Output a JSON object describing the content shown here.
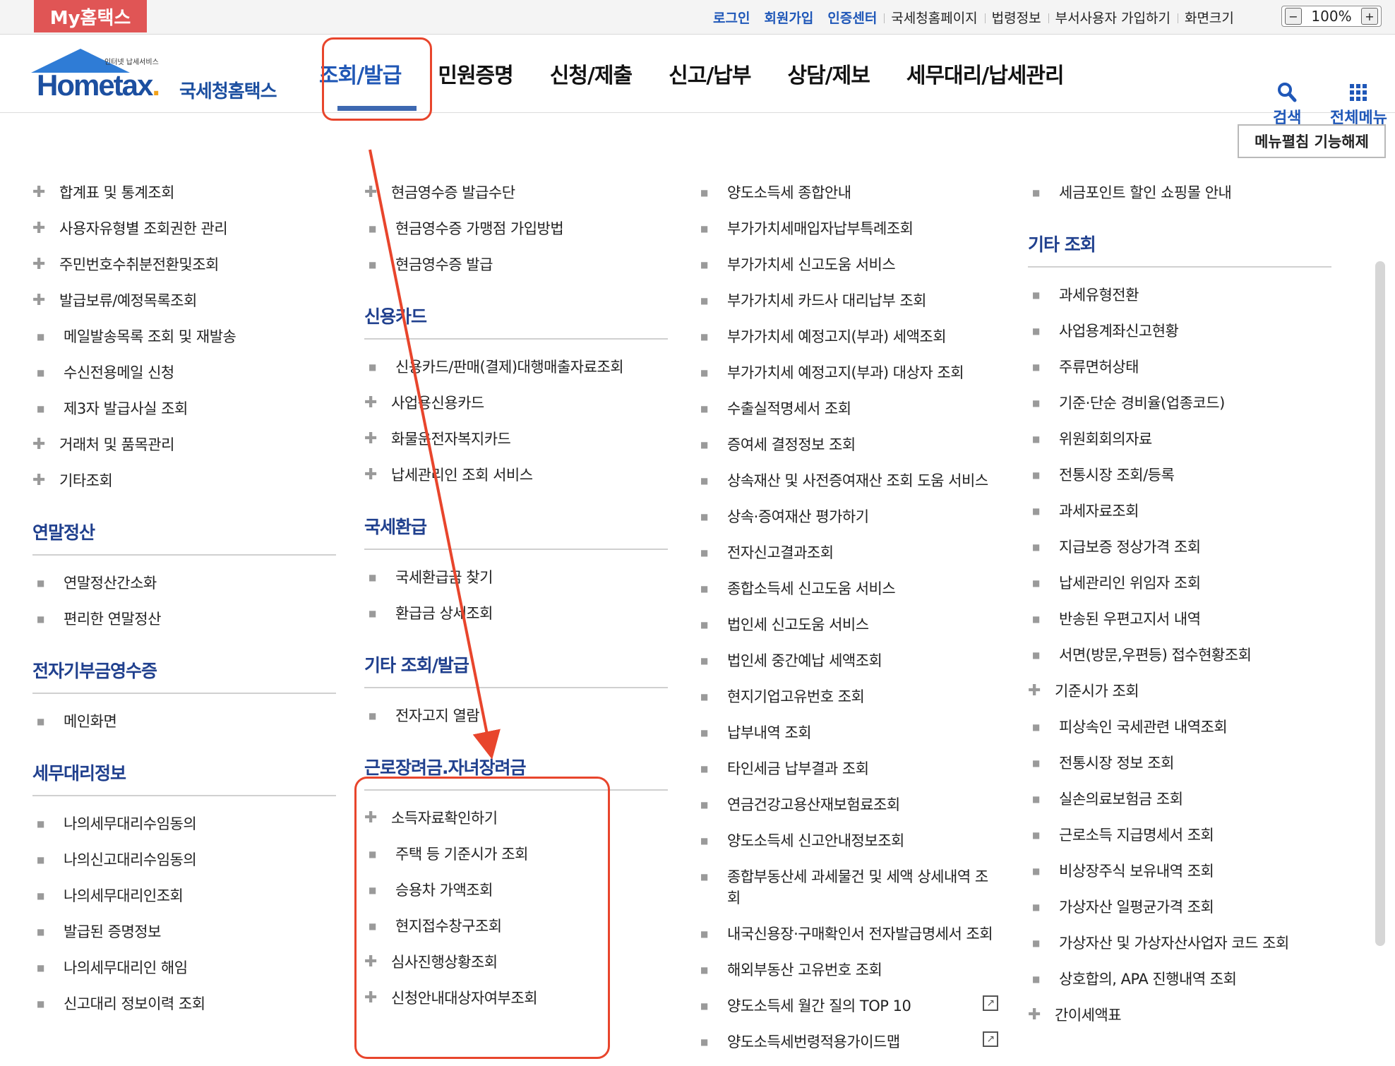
{
  "topbar": {
    "my_button": "My홈택스",
    "links": [
      {
        "label": "로그인",
        "style": "blue"
      },
      {
        "label": "회원가입",
        "style": "blue"
      },
      {
        "label": "인증센터",
        "style": "blue"
      },
      {
        "label": "국세청홈페이지",
        "style": "plain"
      },
      {
        "label": "법령정보",
        "style": "plain"
      },
      {
        "label": "부서사용자 가입하기",
        "style": "plain"
      },
      {
        "label": "화면크기",
        "style": "plain"
      }
    ],
    "zoom": {
      "minus": "−",
      "value": "100%",
      "plus": "+"
    }
  },
  "header": {
    "logo": {
      "small": "인터넷 납세서비스",
      "main": "Hometax",
      "dot": ".",
      "korean": "국세청홈택스"
    },
    "menus": [
      "조회/발급",
      "민원증명",
      "신청/제출",
      "신고/납부",
      "상담/제보",
      "세무대리/납세관리"
    ],
    "active_menu": 0,
    "search": {
      "label": "검색",
      "icon": "search-icon"
    },
    "all_menu": {
      "label": "전체메뉴",
      "icon": "grid-icon"
    }
  },
  "fold_button": "메뉴펼침 기능해제",
  "colors": {
    "accent_blue": "#1f57b8",
    "section_title": "#20408e",
    "highlight_red": "#e8452c",
    "my_button_red": "#e05555"
  },
  "columns": [
    {
      "blocks": [
        {
          "type": "items",
          "items": [
            {
              "icon": "plus",
              "text": "합계표 및 통계조회"
            },
            {
              "icon": "plus",
              "text": "사용자유형별 조회권한 관리"
            },
            {
              "icon": "plus",
              "text": "주민번호수취분전환및조회"
            },
            {
              "icon": "plus",
              "text": "발급보류/예정목록조회"
            },
            {
              "icon": "bullet",
              "text": "메일발송목록 조회 및 재발송"
            },
            {
              "icon": "bullet",
              "text": "수신전용메일 신청"
            },
            {
              "icon": "bullet",
              "text": "제3자 발급사실 조회"
            },
            {
              "icon": "plus",
              "text": "거래처 및 품목관리"
            },
            {
              "icon": "plus",
              "text": "기타조회"
            }
          ]
        },
        {
          "type": "section",
          "title": "연말정산",
          "items": [
            {
              "icon": "bullet",
              "text": "연말정산간소화"
            },
            {
              "icon": "bullet",
              "text": "편리한 연말정산"
            }
          ]
        },
        {
          "type": "section",
          "title": "전자기부금영수증",
          "items": [
            {
              "icon": "bullet",
              "text": "메인화면"
            }
          ]
        },
        {
          "type": "section",
          "title": "세무대리정보",
          "items": [
            {
              "icon": "bullet",
              "text": "나의세무대리수임동의"
            },
            {
              "icon": "bullet",
              "text": "나의신고대리수임동의"
            },
            {
              "icon": "bullet",
              "text": "나의세무대리인조회"
            },
            {
              "icon": "bullet",
              "text": "발급된 증명정보"
            },
            {
              "icon": "bullet",
              "text": "나의세무대리인 해임"
            },
            {
              "icon": "bullet",
              "text": "신고대리 정보이력 조회"
            }
          ]
        }
      ]
    },
    {
      "blocks": [
        {
          "type": "items",
          "items": [
            {
              "icon": "plus",
              "text": "현금영수증 발급수단"
            },
            {
              "icon": "bullet",
              "text": "현금영수증 가맹점 가입방법"
            },
            {
              "icon": "bullet",
              "text": "현금영수증 발급"
            }
          ]
        },
        {
          "type": "section",
          "title": "신용카드",
          "items": [
            {
              "icon": "bullet",
              "text": "신용카드/판매(결제)대행매출자료조회"
            },
            {
              "icon": "plus",
              "text": "사업용신용카드"
            },
            {
              "icon": "plus",
              "text": "화물운전자복지카드"
            },
            {
              "icon": "plus",
              "text": "납세관리인 조회 서비스"
            }
          ]
        },
        {
          "type": "section",
          "title": "국세환급",
          "items": [
            {
              "icon": "bullet",
              "text": "국세환급금 찾기"
            },
            {
              "icon": "bullet",
              "text": "환급금 상세조회"
            }
          ]
        },
        {
          "type": "section",
          "title": "기타 조회/발급",
          "items": [
            {
              "icon": "bullet",
              "text": "전자고지 열람"
            }
          ]
        },
        {
          "type": "section",
          "title": "근로장려금.자녀장려금",
          "items": [
            {
              "icon": "plus",
              "text": "소득자료확인하기"
            },
            {
              "icon": "bullet",
              "text": "주택 등 기준시가 조회"
            },
            {
              "icon": "bullet",
              "text": "승용차 가액조회"
            },
            {
              "icon": "bullet",
              "text": "현지접수창구조회"
            },
            {
              "icon": "plus",
              "text": "심사진행상황조회"
            },
            {
              "icon": "plus",
              "text": "신청안내대상자여부조회"
            }
          ]
        }
      ]
    },
    {
      "blocks": [
        {
          "type": "items",
          "items": [
            {
              "icon": "bullet",
              "text": "양도소득세 종합안내"
            },
            {
              "icon": "bullet",
              "text": "부가가치세매입자납부특례조회"
            },
            {
              "icon": "bullet",
              "text": "부가가치세 신고도움 서비스"
            },
            {
              "icon": "bullet",
              "text": "부가가치세 카드사 대리납부 조회"
            },
            {
              "icon": "bullet",
              "text": "부가가치세 예정고지(부과) 세액조회"
            },
            {
              "icon": "bullet",
              "text": "부가가치세 예정고지(부과) 대상자 조회"
            },
            {
              "icon": "bullet",
              "text": "수출실적명세서 조회"
            },
            {
              "icon": "bullet",
              "text": "증여세 결정정보 조회"
            },
            {
              "icon": "bullet",
              "text": "상속재산 및 사전증여재산 조회 도움 서비스"
            },
            {
              "icon": "bullet",
              "text": "상속·증여재산 평가하기"
            },
            {
              "icon": "bullet",
              "text": "전자신고결과조회"
            },
            {
              "icon": "bullet",
              "text": "종합소득세 신고도움 서비스"
            },
            {
              "icon": "bullet",
              "text": "법인세 신고도움 서비스"
            },
            {
              "icon": "bullet",
              "text": "법인세 중간예납 세액조회"
            },
            {
              "icon": "bullet",
              "text": "현지기업고유번호 조회"
            },
            {
              "icon": "bullet",
              "text": "납부내역 조회"
            },
            {
              "icon": "bullet",
              "text": "타인세금 납부결과 조회"
            },
            {
              "icon": "bullet",
              "text": "연금건강고용산재보험료조회"
            },
            {
              "icon": "bullet",
              "text": "양도소득세 신고안내정보조회"
            },
            {
              "icon": "bullet",
              "text": "종합부동산세 과세물건 및 세액 상세내역 조회",
              "tall": true
            },
            {
              "icon": "bullet",
              "text": "내국신용장·구매확인서 전자발급명세서 조회"
            },
            {
              "icon": "bullet",
              "text": "해외부동산 고유번호 조회"
            },
            {
              "icon": "bullet",
              "text": "양도소득세 월간 질의 TOP 10",
              "external": true
            },
            {
              "icon": "bullet",
              "text": "양도소득세번령적용가이드맵",
              "external": true
            }
          ]
        }
      ]
    },
    {
      "blocks": [
        {
          "type": "items",
          "items": [
            {
              "icon": "bullet",
              "text": "세금포인트 할인 쇼핑몰 안내"
            }
          ]
        },
        {
          "type": "section",
          "title": "기타 조회",
          "items": [
            {
              "icon": "bullet",
              "text": "과세유형전환"
            },
            {
              "icon": "bullet",
              "text": "사업용계좌신고현황"
            },
            {
              "icon": "bullet",
              "text": "주류면허상태"
            },
            {
              "icon": "bullet",
              "text": "기준·단순 경비율(업종코드)"
            },
            {
              "icon": "bullet",
              "text": "위원회회의자료"
            },
            {
              "icon": "bullet",
              "text": "전통시장 조회/등록"
            },
            {
              "icon": "bullet",
              "text": "과세자료조회"
            },
            {
              "icon": "bullet",
              "text": "지급보증 정상가격 조회"
            },
            {
              "icon": "bullet",
              "text": "납세관리인 위임자 조회"
            },
            {
              "icon": "bullet",
              "text": "반송된 우편고지서 내역"
            },
            {
              "icon": "bullet",
              "text": "서면(방문,우편등) 접수현황조회"
            },
            {
              "icon": "plus",
              "text": "기준시가 조회"
            },
            {
              "icon": "bullet",
              "text": "피상속인 국세관련 내역조회"
            },
            {
              "icon": "bullet",
              "text": "전통시장 정보 조회"
            },
            {
              "icon": "bullet",
              "text": "실손의료보험금 조회"
            },
            {
              "icon": "bullet",
              "text": "근로소득 지급명세서 조회"
            },
            {
              "icon": "bullet",
              "text": "비상장주식 보유내역 조회"
            },
            {
              "icon": "bullet",
              "text": "가상자산 일평균가격 조회"
            },
            {
              "icon": "bullet",
              "text": "가상자산 및 가상자산사업자 코드 조회"
            },
            {
              "icon": "bullet",
              "text": "상호합의, APA 진행내역 조회"
            },
            {
              "icon": "plus",
              "text": "간이세액표"
            }
          ]
        }
      ]
    }
  ]
}
